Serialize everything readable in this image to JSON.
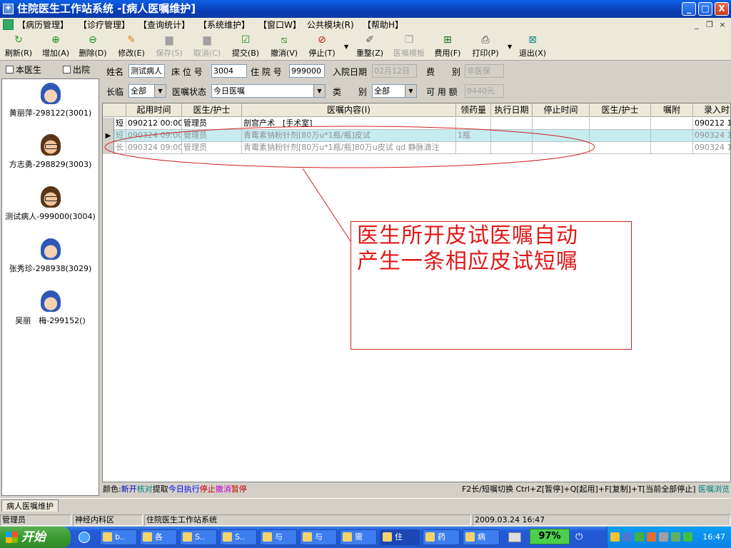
{
  "window": {
    "title": "住院医生工作站系统 -[病人医嘱维护]",
    "app_icon": "doctor-app-icon",
    "controls": {
      "minimize": "_",
      "maximize": "□",
      "close": "X"
    }
  },
  "menu": {
    "items": [
      "【病历管理】",
      "【诊疗管理】",
      "【查询统计】",
      "【系统维护】",
      "【窗口W】",
      "公共模块(R)",
      "【帮助H】"
    ],
    "mdi_controls": {
      "minimize": "_",
      "restore": "❐",
      "close": "×"
    }
  },
  "toolbar": {
    "buttons": [
      {
        "label": "刷新(R)",
        "icon": "refresh-icon",
        "enabled": true
      },
      {
        "label": "增加(A)",
        "icon": "add-icon",
        "enabled": true
      },
      {
        "label": "删除(D)",
        "icon": "delete-icon",
        "enabled": true
      },
      {
        "label": "修改(E)",
        "icon": "edit-icon",
        "enabled": true
      },
      {
        "label": "保存(S)",
        "icon": "save-icon",
        "enabled": false
      },
      {
        "label": "取消(C)",
        "icon": "cancel-icon",
        "enabled": false
      },
      {
        "label": "提交(B)",
        "icon": "submit-icon",
        "enabled": true
      },
      {
        "label": "撤消(V)",
        "icon": "undo-icon",
        "enabled": true
      },
      {
        "label": "停止(T)",
        "icon": "stop-icon",
        "enabled": true
      },
      {
        "label": "重整(Z)",
        "icon": "reorganize-icon",
        "enabled": true
      },
      {
        "label": "医嘱模板",
        "icon": "template-icon",
        "enabled": false
      },
      {
        "label": "费用(F)",
        "icon": "fee-icon",
        "enabled": true
      },
      {
        "label": "打印(P)",
        "icon": "print-icon",
        "enabled": true
      },
      {
        "label": "退出(X)",
        "icon": "exit-icon",
        "enabled": true
      }
    ]
  },
  "left": {
    "check_this_doctor": "本医生",
    "check_discharged": "出院",
    "patients": [
      {
        "label": "黄丽萍-298122(3001)",
        "gender": "f"
      },
      {
        "label": "方志勇-298829(3003)",
        "gender": "m"
      },
      {
        "label": "测试病人-999000(3004)",
        "gender": "m"
      },
      {
        "label": "张秀珍-298938(3029)",
        "gender": "f"
      },
      {
        "label": "吴丽　梅-299152()",
        "gender": "f"
      }
    ]
  },
  "form": {
    "name_label": "姓名",
    "name_value": "测试病人",
    "bed_label": "床 位 号",
    "bed_value": "3004",
    "inpatient_label": "住 院 号",
    "inpatient_value": "999000",
    "admit_label": "入院日期",
    "admit_value": "02月12日",
    "fee_label": "费　　别",
    "fee_value": "非医保",
    "longshort_label": "长临",
    "longshort_value": "全部",
    "status_label": "医嘱状态",
    "status_value": "今日医嘱",
    "category_label": "类　　别",
    "category_value": "全部",
    "avail_label": "可 用 额",
    "avail_value": "9440元"
  },
  "grid": {
    "headers": [
      "起用时间",
      "医生/护士",
      "医嘱内容(I)",
      "领药量",
      "执行日期",
      "停止时间",
      "医生/护士",
      "嘱附",
      "录入时"
    ],
    "rows": [
      {
        "type": "短",
        "start": "090212 00:00",
        "doctor": "管理员",
        "content": "剖宫产术　[手术室]",
        "qty": "",
        "entry": "090212 1",
        "style": "normal"
      },
      {
        "type": "短",
        "start": "090324 09:00",
        "doctor": "管理员",
        "content": "青霉素钠粉针剂[80万u*1瓶/瓶]皮试",
        "qty": "1瓶",
        "entry": "090324 1",
        "style": "selected"
      },
      {
        "type": "长",
        "start": "090324 09:00",
        "doctor": "管理员",
        "content": "青霉素钠粉针剂[80万u*1瓶/瓶]80万u皮试 qd 静脉滴注",
        "qty": "",
        "entry": "090324 1",
        "style": "dim"
      }
    ]
  },
  "legend": {
    "prefix": "颜色:",
    "items": [
      {
        "text": "新开",
        "color": "#0000c0"
      },
      {
        "text": "核对",
        "color": "#008080"
      },
      {
        "text": "提取",
        "color": "#000000"
      },
      {
        "text": "今日执行",
        "color": "#0000ff"
      },
      {
        "text": "停止",
        "color": "#c00000"
      },
      {
        "text": "撤消",
        "color": "#c000c0"
      },
      {
        "text": "暂停",
        "color": "#c00000"
      }
    ],
    "shortcuts": "F2长/短嘱切换 Ctrl+Z[暂停]+Q[起用]+F[复制]+T[当前全部停止]",
    "browse": "医嘱浏览"
  },
  "mdi_tab": "病人医嘱维护",
  "status": {
    "user": "管理员",
    "dept": "神经内科区",
    "system": "住院医生工作站系统",
    "datetime": "2009.03.24 16:47"
  },
  "taskbar": {
    "start": "开始",
    "tasks": [
      "b..",
      "各",
      "S..",
      "S..",
      "与",
      "与",
      "需",
      "住",
      "药",
      "病"
    ],
    "active_index": 7,
    "battery": "97%",
    "clock": "16:47"
  },
  "annotation": {
    "line1": "医生所开皮试医嘱自动",
    "line2": "产生一条相应皮试短嘱"
  }
}
